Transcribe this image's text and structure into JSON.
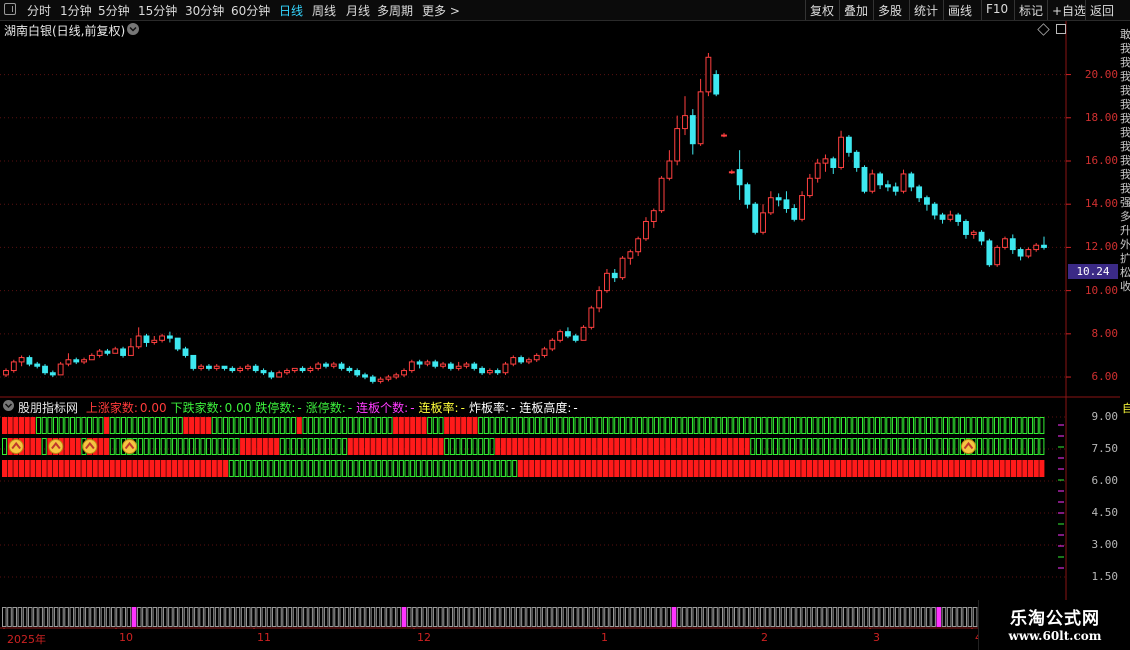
{
  "toolbar": {
    "left_items": [
      "分时",
      "1分钟",
      "5分钟",
      "15分钟",
      "30分钟",
      "60分钟",
      "日线",
      "周线",
      "月线",
      "多周期",
      "更多 >"
    ],
    "active_index": 6,
    "right_items": [
      "复权",
      "叠加",
      "多股",
      "统计",
      "画线",
      "F10",
      "标记",
      "+自选",
      "返回"
    ]
  },
  "main_chart": {
    "title": "湖南白银(日线,前复权)",
    "price_axis": [
      "20.00",
      "18.00",
      "16.00",
      "14.00",
      "12.00",
      "10.00",
      "8.00",
      "6.00"
    ],
    "current_price": "10.24"
  },
  "indicator": {
    "name": "股朋指标网",
    "fields": [
      {
        "label": "上涨家数:",
        "value": "0.00",
        "color": "#ff3b3b"
      },
      {
        "label": "下跌家数:",
        "value": "0.00",
        "color": "#3cf03c"
      },
      {
        "label": "跌停数:",
        "value": "-",
        "color": "#3cf03c"
      },
      {
        "label": "涨停数:",
        "value": "-",
        "color": "#3cf03c"
      },
      {
        "label": "连板个数:",
        "value": "-",
        "color": "#ff3cff"
      },
      {
        "label": "连板率:",
        "value": "-",
        "color": "#ffff3c"
      },
      {
        "label": "炸板率:",
        "value": "-",
        "color": "#ffffff"
      },
      {
        "label": "连板高度:",
        "value": "-",
        "color": "#ffffff"
      }
    ],
    "axis": [
      "9.00",
      "7.50",
      "6.00",
      "4.50",
      "3.00",
      "1.50"
    ]
  },
  "date_axis": [
    {
      "label": "2025年"
    },
    {
      "label": "10"
    },
    {
      "label": "11"
    },
    {
      "label": "12"
    },
    {
      "label": "1"
    },
    {
      "label": "2"
    },
    {
      "label": "3"
    },
    {
      "label": "4"
    }
  ],
  "watermark": {
    "title": "乐淘公式网",
    "url": "www.60lt.com"
  },
  "right_strip": [
    "敢",
    "我",
    "我",
    "我",
    "我",
    "我",
    "我",
    "我",
    "我",
    "我",
    "我",
    "我",
    "强",
    "多",
    "升",
    "外",
    "扩",
    "松",
    "收"
  ],
  "colors": {
    "up": "#ff4040",
    "down": "#3ee8f0",
    "green_block": "#33ee33",
    "red_block": "#ff1a1a",
    "magenta": "#ff33ff",
    "grid": "#5a1010"
  },
  "chart_data": {
    "type": "candlestick",
    "ylim": [
      5.4,
      21.6
    ],
    "candles": [
      [
        6.1,
        6.3,
        6.0,
        6.4
      ],
      [
        6.3,
        6.7,
        6.2,
        6.8
      ],
      [
        6.7,
        6.9,
        6.5,
        7.0
      ],
      [
        6.9,
        6.6,
        6.5,
        7.0
      ],
      [
        6.6,
        6.5,
        6.4,
        6.7
      ],
      [
        6.5,
        6.2,
        6.1,
        6.6
      ],
      [
        6.2,
        6.1,
        6.0,
        6.3
      ],
      [
        6.1,
        6.6,
        6.1,
        6.7
      ],
      [
        6.6,
        6.8,
        6.5,
        7.1
      ],
      [
        6.8,
        6.7,
        6.6,
        6.9
      ],
      [
        6.7,
        6.8,
        6.6,
        6.9
      ],
      [
        6.8,
        7.0,
        6.8,
        7.1
      ],
      [
        7.0,
        7.2,
        6.9,
        7.3
      ],
      [
        7.2,
        7.1,
        7.0,
        7.3
      ],
      [
        7.1,
        7.3,
        7.1,
        7.4
      ],
      [
        7.3,
        7.0,
        6.9,
        7.4
      ],
      [
        7.0,
        7.4,
        7.0,
        7.8
      ],
      [
        7.4,
        7.9,
        7.3,
        8.3
      ],
      [
        7.9,
        7.6,
        7.4,
        8.0
      ],
      [
        7.6,
        7.7,
        7.5,
        7.9
      ],
      [
        7.7,
        7.9,
        7.6,
        8.0
      ],
      [
        7.9,
        7.8,
        7.6,
        8.1
      ],
      [
        7.8,
        7.3,
        7.2,
        7.8
      ],
      [
        7.3,
        7.0,
        6.9,
        7.4
      ],
      [
        7.0,
        6.4,
        6.3,
        7.0
      ],
      [
        6.4,
        6.5,
        6.3,
        6.6
      ],
      [
        6.5,
        6.4,
        6.3,
        6.6
      ],
      [
        6.4,
        6.5,
        6.3,
        6.6
      ],
      [
        6.5,
        6.4,
        6.3,
        6.5
      ],
      [
        6.4,
        6.3,
        6.2,
        6.5
      ],
      [
        6.3,
        6.4,
        6.2,
        6.5
      ],
      [
        6.4,
        6.5,
        6.3,
        6.6
      ],
      [
        6.5,
        6.3,
        6.2,
        6.6
      ],
      [
        6.3,
        6.2,
        6.1,
        6.4
      ],
      [
        6.2,
        6.0,
        5.9,
        6.3
      ],
      [
        6.0,
        6.2,
        6.0,
        6.3
      ],
      [
        6.2,
        6.3,
        6.1,
        6.4
      ],
      [
        6.3,
        6.4,
        6.2,
        6.4
      ],
      [
        6.4,
        6.3,
        6.2,
        6.5
      ],
      [
        6.3,
        6.4,
        6.2,
        6.5
      ],
      [
        6.4,
        6.6,
        6.3,
        6.7
      ],
      [
        6.6,
        6.5,
        6.4,
        6.7
      ],
      [
        6.5,
        6.6,
        6.4,
        6.7
      ],
      [
        6.6,
        6.4,
        6.3,
        6.7
      ],
      [
        6.4,
        6.3,
        6.2,
        6.5
      ],
      [
        6.3,
        6.1,
        6.0,
        6.4
      ],
      [
        6.1,
        6.0,
        5.9,
        6.2
      ],
      [
        6.0,
        5.8,
        5.7,
        6.1
      ],
      [
        5.8,
        5.9,
        5.7,
        6.0
      ],
      [
        5.9,
        6.0,
        5.8,
        6.1
      ],
      [
        6.0,
        6.1,
        5.9,
        6.2
      ],
      [
        6.1,
        6.3,
        6.0,
        6.4
      ],
      [
        6.3,
        6.7,
        6.2,
        6.8
      ],
      [
        6.7,
        6.6,
        6.4,
        6.8
      ],
      [
        6.6,
        6.7,
        6.5,
        6.8
      ],
      [
        6.7,
        6.5,
        6.4,
        6.8
      ],
      [
        6.5,
        6.6,
        6.4,
        6.7
      ],
      [
        6.6,
        6.4,
        6.3,
        6.7
      ],
      [
        6.4,
        6.5,
        6.3,
        6.7
      ],
      [
        6.5,
        6.6,
        6.4,
        6.7
      ],
      [
        6.6,
        6.4,
        6.3,
        6.7
      ],
      [
        6.4,
        6.2,
        6.1,
        6.5
      ],
      [
        6.2,
        6.3,
        6.1,
        6.4
      ],
      [
        6.3,
        6.2,
        6.1,
        6.4
      ],
      [
        6.2,
        6.6,
        6.1,
        6.7
      ],
      [
        6.6,
        6.9,
        6.5,
        7.0
      ],
      [
        6.9,
        6.7,
        6.6,
        7.0
      ],
      [
        6.7,
        6.8,
        6.6,
        6.9
      ],
      [
        6.8,
        7.0,
        6.7,
        7.1
      ],
      [
        7.0,
        7.3,
        6.9,
        7.4
      ],
      [
        7.3,
        7.7,
        7.2,
        7.8
      ],
      [
        7.7,
        8.1,
        7.6,
        8.2
      ],
      [
        8.1,
        7.9,
        7.8,
        8.3
      ],
      [
        7.9,
        7.7,
        7.6,
        8.0
      ],
      [
        7.7,
        8.3,
        7.7,
        8.4
      ],
      [
        8.3,
        9.2,
        8.2,
        9.3
      ],
      [
        9.2,
        10.0,
        9.0,
        10.2
      ],
      [
        10.0,
        10.8,
        9.9,
        11.0
      ],
      [
        10.8,
        10.6,
        10.4,
        11.0
      ],
      [
        10.6,
        11.5,
        10.5,
        11.6
      ],
      [
        11.5,
        11.8,
        11.2,
        11.9
      ],
      [
        11.8,
        12.4,
        11.6,
        12.5
      ],
      [
        12.4,
        13.2,
        12.3,
        13.4
      ],
      [
        13.2,
        13.7,
        12.9,
        13.8
      ],
      [
        13.7,
        15.2,
        13.6,
        15.3
      ],
      [
        15.2,
        16.0,
        15.1,
        16.5
      ],
      [
        16.0,
        17.5,
        15.8,
        18.1
      ],
      [
        17.5,
        18.1,
        17.2,
        19.0
      ],
      [
        18.1,
        16.8,
        16.3,
        18.4
      ],
      [
        16.8,
        19.2,
        16.7,
        19.8
      ],
      [
        19.2,
        20.8,
        19.0,
        21.0
      ],
      [
        20.0,
        19.1,
        19.0,
        20.2
      ],
      [
        17.2,
        17.2,
        17.1,
        17.3
      ],
      [
        15.5,
        15.5,
        15.4,
        15.6
      ],
      [
        15.6,
        14.9,
        14.2,
        16.5
      ],
      [
        14.9,
        14.0,
        13.8,
        15.0
      ],
      [
        14.0,
        12.7,
        12.6,
        14.1
      ],
      [
        12.7,
        13.6,
        12.6,
        14.0
      ],
      [
        13.6,
        14.3,
        13.5,
        14.6
      ],
      [
        14.3,
        14.2,
        13.9,
        14.5
      ],
      [
        14.2,
        13.8,
        13.6,
        14.6
      ],
      [
        13.8,
        13.3,
        13.2,
        14.0
      ],
      [
        13.3,
        14.4,
        13.2,
        14.6
      ],
      [
        14.4,
        15.2,
        14.3,
        15.4
      ],
      [
        15.2,
        15.9,
        15.0,
        16.1
      ],
      [
        15.9,
        16.1,
        15.5,
        16.3
      ],
      [
        16.1,
        15.7,
        15.4,
        16.2
      ],
      [
        15.7,
        17.1,
        15.6,
        17.4
      ],
      [
        17.1,
        16.4,
        16.2,
        17.2
      ],
      [
        16.4,
        15.7,
        15.5,
        16.5
      ],
      [
        15.7,
        14.6,
        14.5,
        15.8
      ],
      [
        14.6,
        15.4,
        14.5,
        15.6
      ],
      [
        15.4,
        14.9,
        14.7,
        15.5
      ],
      [
        14.9,
        14.8,
        14.6,
        15.1
      ],
      [
        14.8,
        14.6,
        14.4,
        15.0
      ],
      [
        14.6,
        15.4,
        14.5,
        15.6
      ],
      [
        15.4,
        14.8,
        14.6,
        15.5
      ],
      [
        14.8,
        14.3,
        14.1,
        14.9
      ],
      [
        14.3,
        14.0,
        13.7,
        14.4
      ],
      [
        14.0,
        13.5,
        13.3,
        14.1
      ],
      [
        13.5,
        13.3,
        13.1,
        13.6
      ],
      [
        13.3,
        13.5,
        13.2,
        13.7
      ],
      [
        13.5,
        13.2,
        13.0,
        13.6
      ],
      [
        13.2,
        12.6,
        12.4,
        13.3
      ],
      [
        12.6,
        12.7,
        12.4,
        12.8
      ],
      [
        12.7,
        12.3,
        12.1,
        12.8
      ],
      [
        12.3,
        11.2,
        11.1,
        12.4
      ],
      [
        11.2,
        12.0,
        11.1,
        12.1
      ],
      [
        12.0,
        12.4,
        11.9,
        12.5
      ],
      [
        12.4,
        11.9,
        11.7,
        12.6
      ],
      [
        11.9,
        11.6,
        11.4,
        12.0
      ],
      [
        11.6,
        11.9,
        11.5,
        12.0
      ],
      [
        11.9,
        12.1,
        11.8,
        12.2
      ],
      [
        12.1,
        12.0,
        11.9,
        12.5
      ]
    ],
    "indicator_rows": [
      "RRRRRRGGGGGGGGGGGGRGGGGGGGGGGGGGRRRRRGGGGGGGGGGGGGGGRGGGGGGGGGGGGGGGGRRRRRRGGGRRRRRRGGGGGGGGGGGGGGGGGGGGGGGGGGGGGGGGGGGGGGGGGGGGGGGGGGGGGGGGGGGGGGGGGGGGGGGGGGGGGGGGGGGGGGGGGGGGGGGGGGGG",
      "GRRRRRRGRRRRRRGRRRRGGGGGGGGGGGGGGGGGGGGGGGRRRRRRRGGGGGGGGGGGGRRRRRRRRRRRRRRRRRGGGGGGGGGRRRRRRRRRRRRRRRRRRRRRRRRRRRRRRRRRRRRRRRRRRRRRGGGGGGGGGGGGGGGGGGGGGGGGGGGGGGGGGGGGGGGGGGGGGGGGGGGGGGGGGGGGRR",
      "RRRRRRRRRRRRRRRRRRRRRRRRRRRRRRRRRRRRRRRRGGGGGGGGGGGGGGGGGGGGGGGGGGGGGGGGGGGGGGGGGGGGGGGGGGGRRRRRRRRRRRRRRRRRRRRRRRRRRRRRRRRRRRRRRRRRRRRRRRRRRRRRRRRRRRRRRRRRRRRRRRRRRRRRRRRRRRRRRRRRRRRRRRRRRRRRRRR"
    ],
    "icon_positions": [
      2,
      9,
      15,
      22,
      170
    ],
    "bottom_magenta": [
      25,
      77,
      129,
      180
    ]
  }
}
